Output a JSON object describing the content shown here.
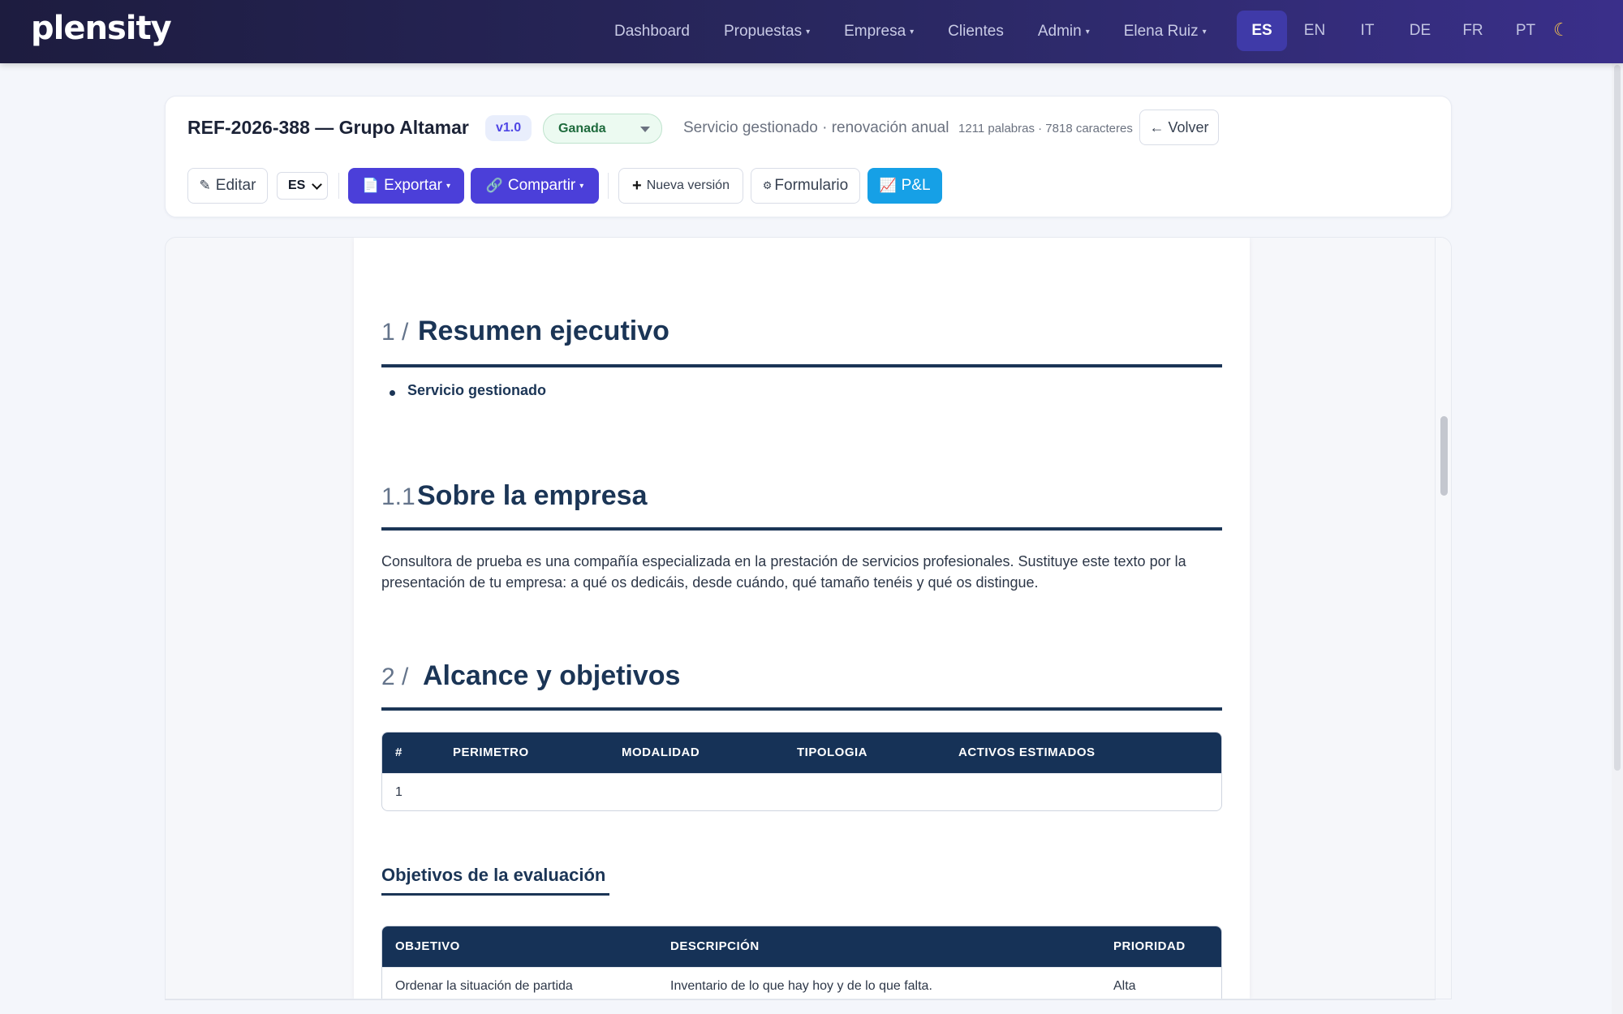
{
  "nav": {
    "brand": "plensity",
    "links": [
      {
        "label": "Dashboard",
        "caret": false
      },
      {
        "label": "Propuestas",
        "caret": true
      },
      {
        "label": "Empresa",
        "caret": true
      },
      {
        "label": "Clientes",
        "caret": false
      },
      {
        "label": "Admin",
        "caret": true
      },
      {
        "label": "Elena Ruiz",
        "caret": true
      }
    ],
    "languages": [
      "ES",
      "EN",
      "IT",
      "DE",
      "FR",
      "PT"
    ],
    "active_language": "ES",
    "caret_glyph": "▾",
    "theme_toggle_icon": "☾"
  },
  "header": {
    "title": "REF-2026-388 — Grupo Altamar",
    "version": "v1.0",
    "status": "Ganada",
    "subtitle": "Servicio gestionado · renovación anual",
    "counts": "1211 palabras · 7818 caracteres",
    "back_label": "← Volver"
  },
  "toolbar": {
    "edit_icon": "✎",
    "edit_label": "Editar",
    "language_select_value": "ES",
    "export_icon": "📄",
    "export_label": "Exportar",
    "share_icon": "🔗",
    "share_label": "Compartir",
    "new_version_icon": "+",
    "new_version_label": "Nueva versión",
    "form_icon": "⚙",
    "form_label": "Formulario",
    "pl_icon": "📈",
    "pl_label": "P&L"
  },
  "document": {
    "section1": {
      "number": "1 /",
      "title": "Resumen ejecutivo",
      "bullet": "Servicio gestionado"
    },
    "section1_1": {
      "number": "1.1",
      "title": "Sobre la empresa",
      "body": "Consultora de prueba es una compañía especializada en la prestación de servicios profesionales. Sustituye este texto por la presentación de tu empresa: a qué os dedicáis, desde cuándo, qué tamaño tenéis y qué os distingue."
    },
    "section2": {
      "number": "2 /",
      "title": "Alcance y objetivos"
    },
    "scope_table": {
      "headers": [
        "#",
        "PERIMETRO",
        "MODALIDAD",
        "TIPOLOGIA",
        "ACTIVOS ESTIMADOS"
      ],
      "rows": [
        [
          "1",
          "",
          "",
          "",
          ""
        ]
      ]
    },
    "objectives_heading": "Objetivos de la evaluación",
    "objectives_table": {
      "headers": [
        "OBJETIVO",
        "DESCRIPCIÓN",
        "PRIORIDAD"
      ],
      "rows": [
        [
          "Ordenar la situación de partida",
          "Inventario de lo que hay hoy y de lo que falta.",
          "Alta"
        ]
      ]
    }
  },
  "colors": {
    "nav_gradient_start": "#1d1c3f",
    "nav_gradient_end": "#3a2f8a",
    "primary": "#4b3fd9",
    "sky": "#16a0e6",
    "heading": "#1b3556",
    "status_green": "#1e6b3d"
  }
}
